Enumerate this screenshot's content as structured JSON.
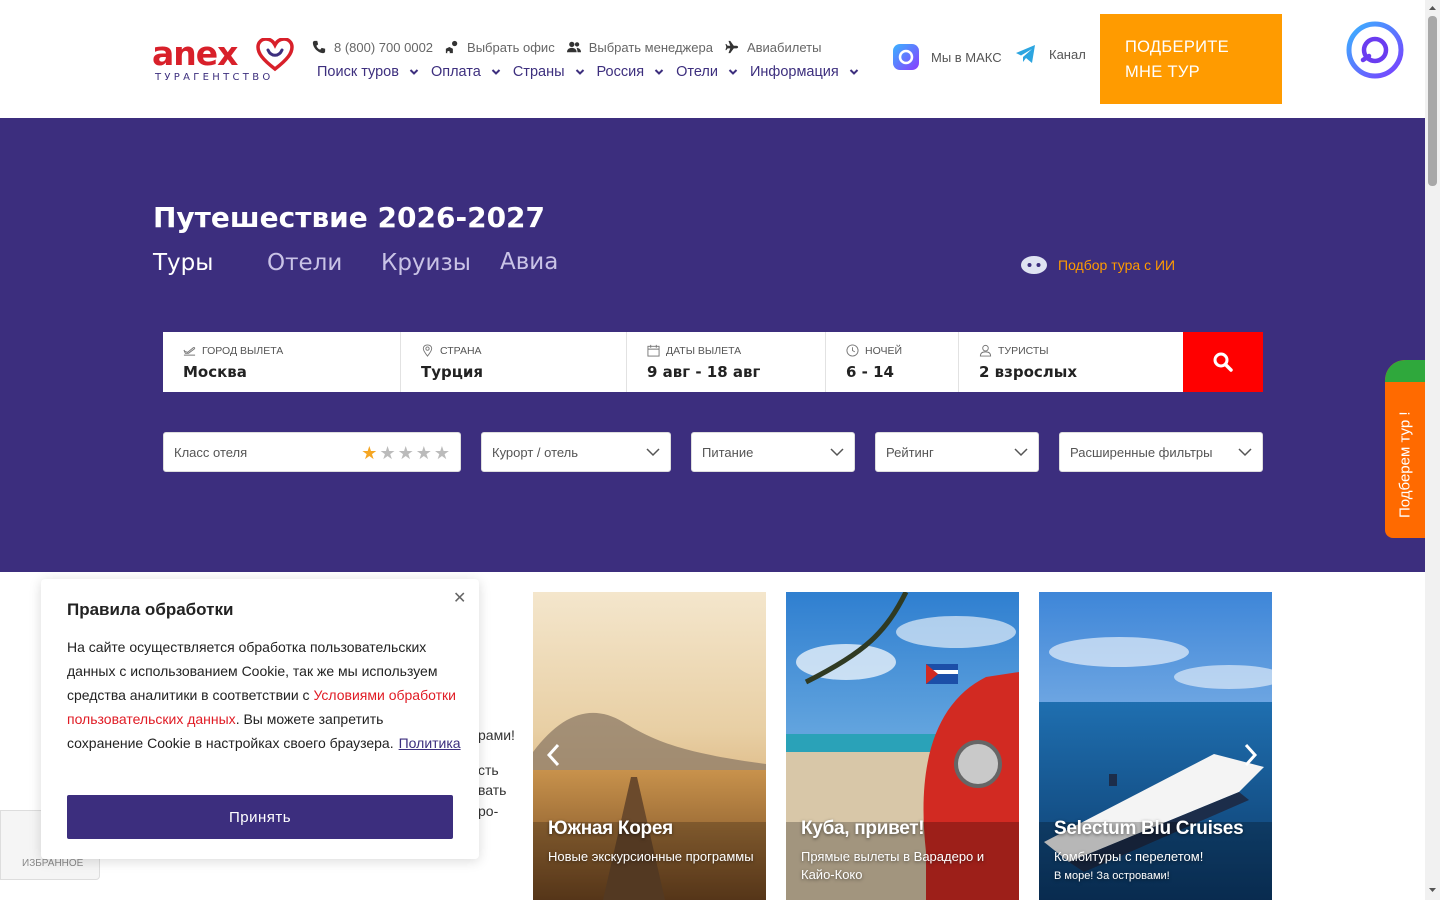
{
  "header": {
    "logo_word": "anex",
    "logo_sub": "ТУРАГЕНТСТВО",
    "top_links": [
      {
        "label": "8 (800) 700 0002",
        "icon": "phone-icon"
      },
      {
        "label": "Выбрать офис",
        "icon": "office-icon"
      },
      {
        "label": "Выбрать менеджера",
        "icon": "users-icon"
      },
      {
        "label": "Авиабилеты",
        "icon": "plane-icon"
      }
    ],
    "nav": [
      "Поиск туров",
      "Оплата",
      "Страны",
      "Россия",
      "Отели",
      "Информация"
    ],
    "social": [
      {
        "label": "Мы в МАКС",
        "icon": "max-messenger-icon"
      },
      {
        "label": "Канал",
        "icon": "telegram-icon"
      }
    ],
    "cta_label": "ПОДБЕРИТЕ МНЕ ТУР"
  },
  "hero": {
    "title": "Путешествие 2026-2027",
    "tabs": [
      "Туры",
      "Отели",
      "Круизы",
      "Авиа"
    ],
    "active_tab": "Туры",
    "ai_label": "Подбор тура с ИИ"
  },
  "search": {
    "fields": [
      {
        "label": "ГОРОД ВЫЛЕТА",
        "value": "Москва",
        "icon": "plane-depart-icon"
      },
      {
        "label": "СТРАНА",
        "value": "Турция",
        "icon": "location-pin-icon"
      },
      {
        "label": "ДАТЫ ВЫЛЕТА",
        "value": "9 авг - 18 авг",
        "icon": "calendar-icon"
      },
      {
        "label": "НОЧЕЙ",
        "value": "6 - 14",
        "icon": "clock-icon"
      },
      {
        "label": "ТУРИСТЫ",
        "value": "2 взрослых",
        "icon": "user-icon"
      }
    ]
  },
  "filters": {
    "hotel_class": "Класс отеля",
    "hotel_stars_selected": 1,
    "hotel_stars_total": 5,
    "resort": "Курорт / отель",
    "food": "Питание",
    "rating": "Рейтинг",
    "advanced": "Расширенные фильтры"
  },
  "side_tab": "Подберем тур !",
  "behind_text": {
    "line1": "рами!",
    "line2": "сть",
    "line3": "вать",
    "line4": "ро-"
  },
  "cards": [
    {
      "title": "Южная Корея",
      "subtitle": "Новые экскурсионные программы"
    },
    {
      "title": "Куба, привет!",
      "subtitle": "Прямые вылеты в Варадеро и Кайо-Коко"
    },
    {
      "title": "Selectum Blu Cruises",
      "subtitle": "Комбитуры с перелетом!",
      "subtitle2": "В море! За островами!"
    }
  ],
  "favorites_label": "ИЗБРАННОЕ",
  "cookie": {
    "title": "Правила обработки",
    "text_before": "На сайте осуществляется обработка пользовательских данных с использованием Cookie, так же мы используем средства аналитики в соответствии с ",
    "link": "Условиями обработки пользовательских данных",
    "text_after": ". Вы можете запретить сохранение Cookie в настройках своего браузера.",
    "policy_link": "Политика",
    "accept_label": "Принять"
  },
  "colors": {
    "brand_purple": "#3c2e7e",
    "brand_red": "#d8202a",
    "accent_orange": "#ff9b00",
    "search_red": "#ff0000"
  }
}
